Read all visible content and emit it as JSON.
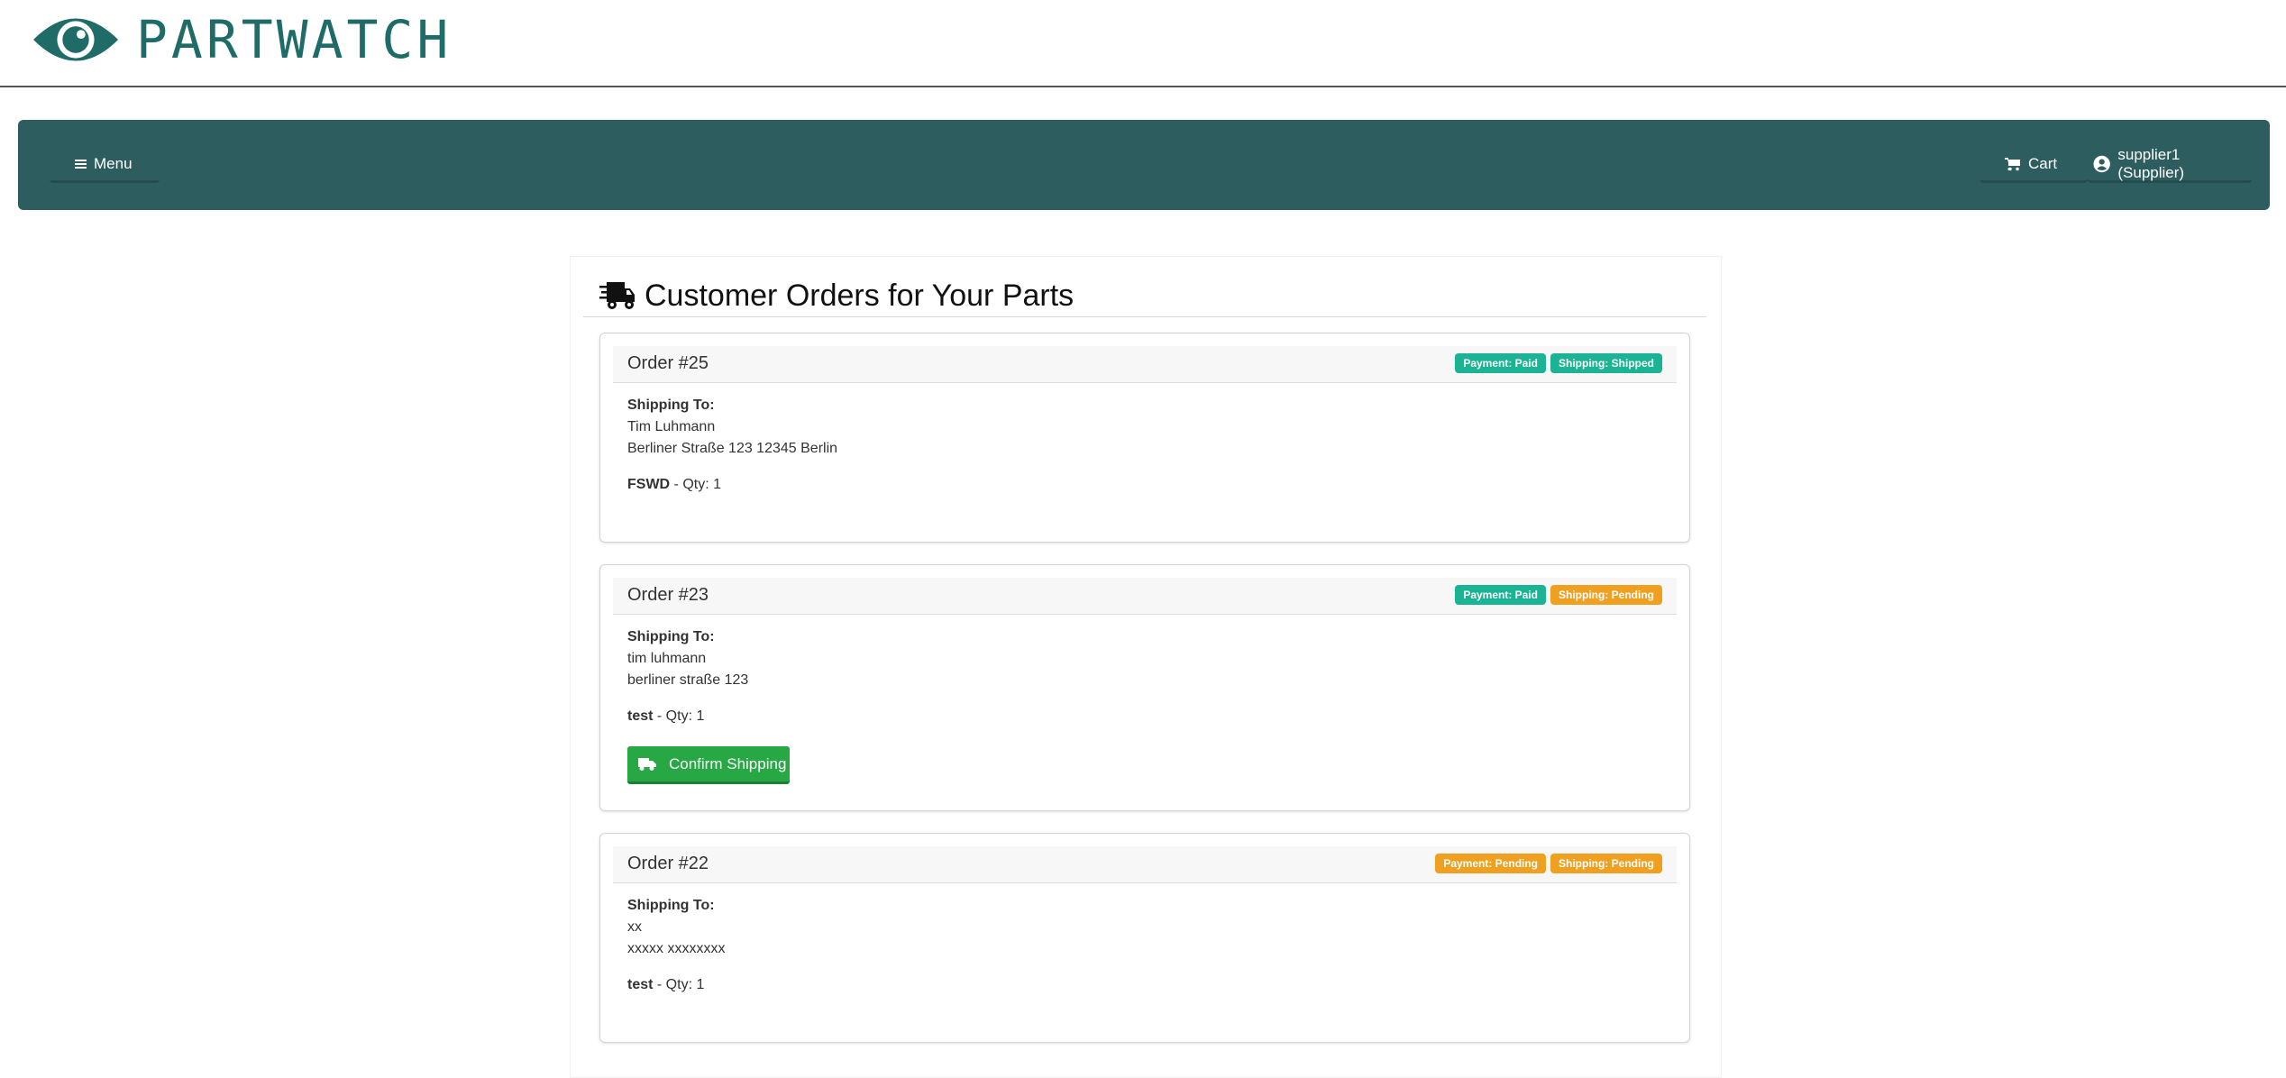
{
  "brand": {
    "name": "PARTWATCH",
    "color": "#1e6b68"
  },
  "navbar": {
    "background": "#2e5d60",
    "menu_label": "Menu",
    "cart_label": "Cart",
    "user_label": "supplier1 (Supplier)"
  },
  "page": {
    "title": "Customer Orders for Your Parts"
  },
  "orders": [
    {
      "title": "Order #25",
      "payment_badge": "Payment: Paid",
      "shipping_badge": "Shipping: Shipped",
      "shipping_to_label": "Shipping To:",
      "name": "Tim Luhmann",
      "address": "Berliner Straße 123 12345 Berlin",
      "part": "FSWD",
      "qty": " - Qty: 1"
    },
    {
      "title": "Order #23",
      "payment_badge": "Payment: Paid",
      "shipping_badge": "Shipping: Pending",
      "shipping_to_label": "Shipping To:",
      "name": "tim luhmann",
      "address": "berliner straße 123",
      "part": "test",
      "qty": " - Qty: 1",
      "action_label": "Confirm Shipping"
    },
    {
      "title": "Order #22",
      "payment_badge": "Payment: Pending",
      "shipping_badge": "Shipping: Pending",
      "shipping_to_label": "Shipping To:",
      "name": "xx",
      "address": "xxxxx xxxxxxxx",
      "part": "test",
      "qty": " - Qty: 1"
    }
  ],
  "status_colors": {
    "paid": "#1ab394",
    "pending": "#f0a020",
    "confirm": "#28a745"
  }
}
